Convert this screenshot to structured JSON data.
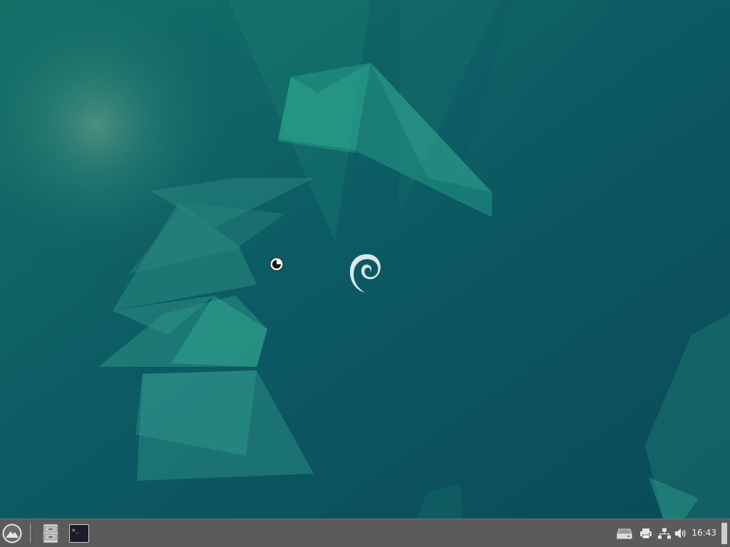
{
  "desktop": {
    "wallpaper_name": "debian-geometric-teal-wallpaper",
    "colors": {
      "base": "#0a4f5c",
      "accent": "#1e8a78",
      "logo": "#d8e8ea"
    }
  },
  "taskbar": {
    "whisker_menu_icon": "whisker-menu-icon",
    "launchers": [
      {
        "name": "file-manager-launcher",
        "icon": "file-cabinet-icon"
      },
      {
        "name": "terminal-launcher",
        "icon": "terminal-icon",
        "prompt": ">_"
      }
    ],
    "tray": [
      {
        "name": "tray-disk-icon",
        "icon": "removable-drive-icon"
      },
      {
        "name": "tray-printer-icon",
        "icon": "printer-icon"
      },
      {
        "name": "tray-network-icon",
        "icon": "network-wired-icon"
      },
      {
        "name": "tray-volume-icon",
        "icon": "speaker-icon"
      }
    ],
    "clock": "16:43",
    "colors": {
      "background": "#5b5b5b",
      "text": "#f2f2f2"
    }
  }
}
